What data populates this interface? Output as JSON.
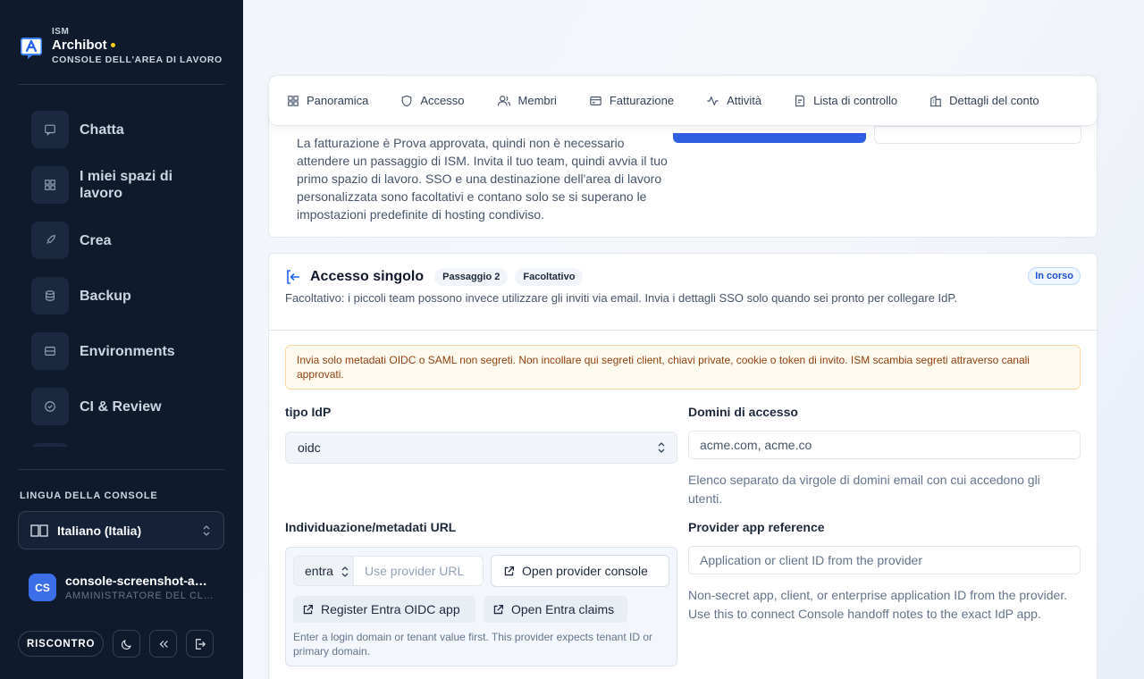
{
  "sidebar": {
    "org": "ISM",
    "app_name": "Archibot",
    "subtitle": "CONSOLE DELL'AREA DI LAVORO",
    "nav": [
      {
        "label": "Chatta",
        "icon": "chat-icon"
      },
      {
        "label": "I miei spazi di lavoro",
        "icon": "grid-icon"
      },
      {
        "label": "Crea",
        "icon": "rocket-icon"
      },
      {
        "label": "Backup",
        "icon": "database-icon"
      },
      {
        "label": "Environments",
        "icon": "server-icon"
      },
      {
        "label": "CI & Review",
        "icon": "check-circle-icon"
      }
    ],
    "language_title": "LINGUA DELLA CONSOLE",
    "language_value": "Italiano (Italia)",
    "user": {
      "initials": "CS",
      "name": "console-screenshot-admin",
      "role": "AMMINISTRATORE DEL CLIENTE"
    },
    "feedback_label": "RISCONTRO"
  },
  "tabs": [
    {
      "label": "Panoramica",
      "icon": "grid-icon"
    },
    {
      "label": "Accesso",
      "icon": "shield-icon"
    },
    {
      "label": "Membri",
      "icon": "users-icon"
    },
    {
      "label": "Fatturazione",
      "icon": "credit-card-icon"
    },
    {
      "label": "Attività",
      "icon": "activity-icon"
    },
    {
      "label": "Lista di controllo",
      "icon": "checklist-icon"
    },
    {
      "label": "Dettagli del conto",
      "icon": "building-icon"
    }
  ],
  "top_card": {
    "text": "La fatturazione è Prova approvata, quindi non è necessario attendere un passaggio di ISM. Invita il tuo team, quindi avvia il tuo primo spazio di lavoro. SSO e una destinazione dell'area di lavoro personalizzata sono facoltativi e contano solo se si superano le impostazioni predefinite di hosting condiviso."
  },
  "sso": {
    "title": "Accesso singolo",
    "step_badge": "Passaggio 2",
    "optional_badge": "Facoltativo",
    "status": "In corso",
    "description": "Facoltativo: i piccoli team possono invece utilizzare gli inviti via email. Invia i dettagli SSO solo quando sei pronto per collegare IdP.",
    "warning": "Invia solo metadati OIDC o SAML non segreti. Non incollare qui segreti client, chiavi private, cookie o token di invito. ISM scambia segreti attraverso canali approvati.",
    "idp_type_label": "tipo IdP",
    "idp_type_value": "oidc",
    "domains_label": "Domini di accesso",
    "domains_value": "acme.com, acme.co",
    "domains_help": "Elenco separato da virgole di domini email con cui accedono gli utenti.",
    "url_label": "Individuazione/metadati URL",
    "provider_value": "entra",
    "url_placeholder": "Use provider URL",
    "open_console_label": "Open provider console",
    "register_label": "Register Entra OIDC app",
    "claims_label": "Open Entra claims",
    "url_help": "Enter a login domain or tenant value first. This provider expects tenant ID or primary domain.",
    "app_ref_label": "Provider app reference",
    "app_ref_placeholder": "Application or client ID from the provider",
    "app_ref_help": "Non-secret app, client, or enterprise application ID from the provider. Use this to connect Console handoff notes to the exact IdP app."
  },
  "colors": {
    "sidebar_bg": "#0f1b2d",
    "accent": "#2f5fe0",
    "status_blue": "#1d4ed8",
    "warning_text": "#92400e"
  }
}
